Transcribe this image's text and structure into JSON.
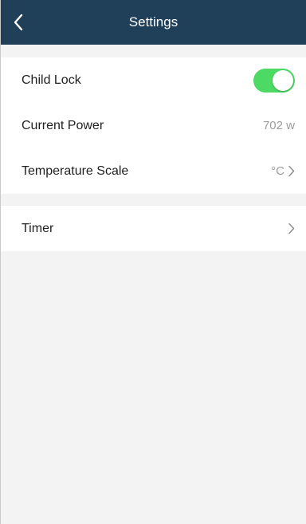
{
  "nav": {
    "title": "Settings",
    "back_icon": "chevron-left-icon",
    "background": "#1f4058"
  },
  "settings": {
    "child_lock": {
      "label": "Child Lock",
      "enabled": true,
      "toggle_color": "#4cd964"
    },
    "current_power": {
      "label": "Current Power",
      "value": "702 w"
    },
    "temperature_scale": {
      "label": "Temperature Scale",
      "value": "°C",
      "icon": "chevron-right-icon"
    },
    "timer": {
      "label": "Timer",
      "icon": "chevron-right-icon"
    }
  }
}
